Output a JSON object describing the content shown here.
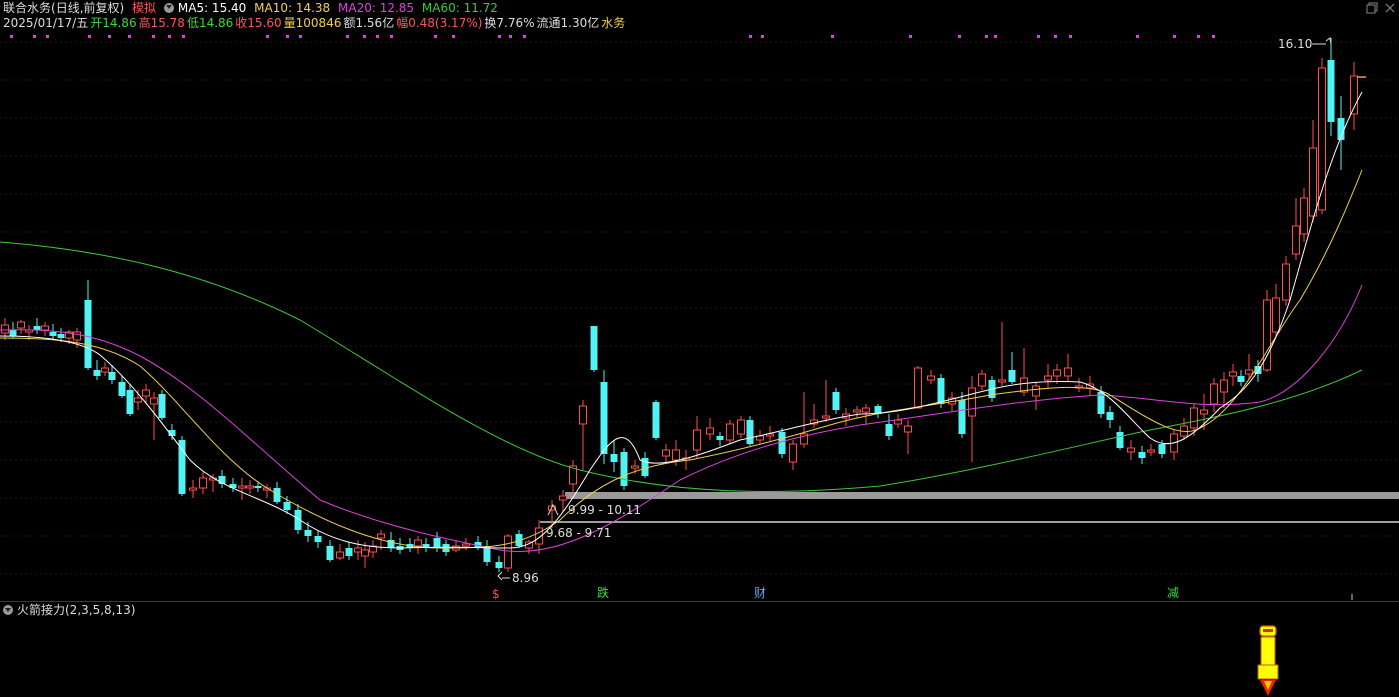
{
  "header": {
    "stock_name": "联合水务",
    "period": "(日线,前复权)",
    "mode": "模拟",
    "ma5": "MA5: 15.40",
    "ma10": "MA10: 14.38",
    "ma20": "MA20: 12.85",
    "ma60": "MA60: 11.72"
  },
  "info": {
    "date": "2025/01/17/五",
    "open": "开14.86",
    "high": "高15.78",
    "low": "低14.86",
    "close": "收15.60",
    "volume": "量100846",
    "amount": "额1.56亿",
    "change": "幅0.48(3.17%)",
    "turnover": "换7.76%",
    "float": "流通1.30亿",
    "sector": "水务"
  },
  "colors": {
    "up": "#ff4d4d",
    "down": "#4ff3f3",
    "ma5": "#ffffff",
    "ma10": "#f0d050",
    "ma20": "#e040e0",
    "ma60": "#3cc83c",
    "accent": "#e07060"
  },
  "annotations": {
    "high_label": "16.10",
    "low_label": "8.96",
    "zone1_label": "9.99 - 10.11",
    "zone2_label": "9.68 - 9.71",
    "event_s": "$",
    "event_die": "跌",
    "event_cai": "财",
    "event_jian": "减"
  },
  "indicator": {
    "title": "火箭接力(2,3,5,8,13)"
  }
}
